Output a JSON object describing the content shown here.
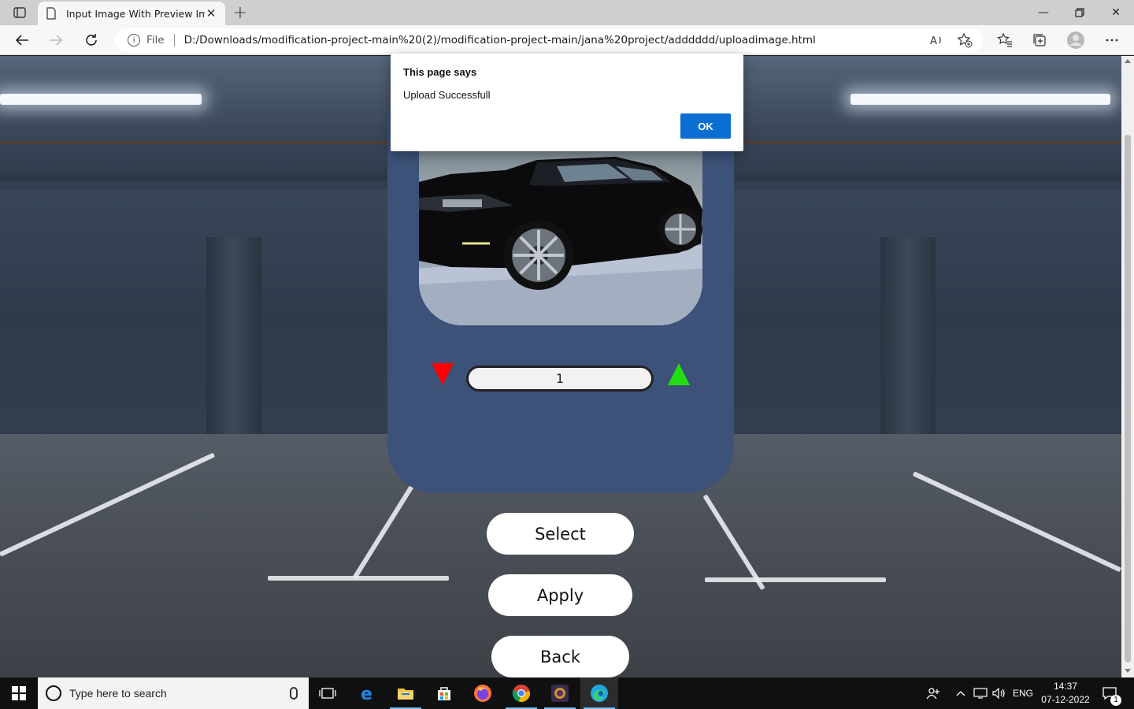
{
  "browser": {
    "tab_title": "Input Image With Preview Image",
    "address_prefix": "File",
    "url": "D:/Downloads/modification-project-main%20(2)/modification-project-main/jana%20project/adddddd/uploadimage.html",
    "icons": [
      "sidebar-icon",
      "document-icon",
      "close-icon",
      "plus-icon",
      "minimize-icon",
      "restore-icon",
      "close-window-icon",
      "back-arrow-icon",
      "forward-arrow-icon",
      "refresh-icon",
      "info-icon",
      "read-aloud-icon",
      "favorite-add-icon",
      "favorites-icon",
      "collections-icon",
      "profile-icon",
      "more-icon"
    ]
  },
  "alert": {
    "title": "This page says",
    "message": "Upload Successfull",
    "ok_label": "OK",
    "ok_color": "#0b6fd1"
  },
  "page": {
    "panel_color": "#3d5279",
    "quantity_value": "1",
    "decrease_color": "#ff0000",
    "increase_color": "#22dd11",
    "select_label": "Select",
    "apply_label": "Apply",
    "back_label": "Back"
  },
  "taskbar": {
    "search_placeholder": "Type here to search",
    "language": "ENG",
    "time": "14:37",
    "date": "07-12-2022",
    "notification_count": "1",
    "apps": [
      "task-view",
      "edge-legacy",
      "file-explorer",
      "store",
      "firefox",
      "chrome",
      "game-app",
      "edge"
    ]
  }
}
